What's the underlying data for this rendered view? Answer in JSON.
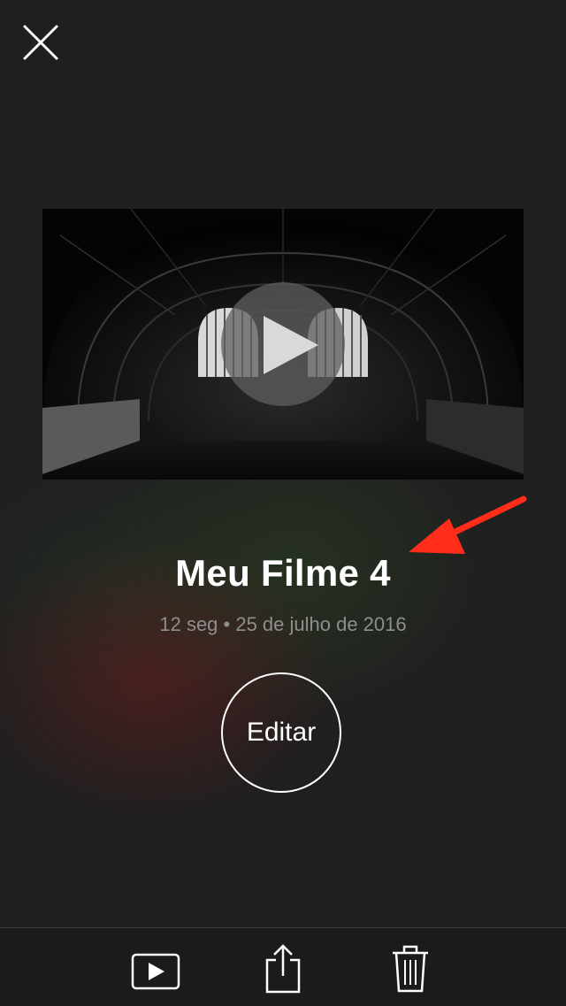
{
  "header": {
    "close_icon": "close-icon"
  },
  "video": {
    "thumbnail_description_icon": "arched-tunnel-thumbnail",
    "play_icon": "play-icon"
  },
  "project": {
    "title": "Meu Filme 4",
    "meta": "12 seg • 25 de julho de 2016"
  },
  "actions": {
    "edit_label": "Editar"
  },
  "annotation": {
    "arrow_color": "#ff2d1a"
  },
  "toolbar": {
    "items": [
      {
        "icon": "play-box-icon"
      },
      {
        "icon": "share-icon"
      },
      {
        "icon": "trash-icon"
      }
    ]
  },
  "colors": {
    "background": "#1f1f1f",
    "text_primary": "#ffffff",
    "text_secondary": "#8e8e8e"
  }
}
